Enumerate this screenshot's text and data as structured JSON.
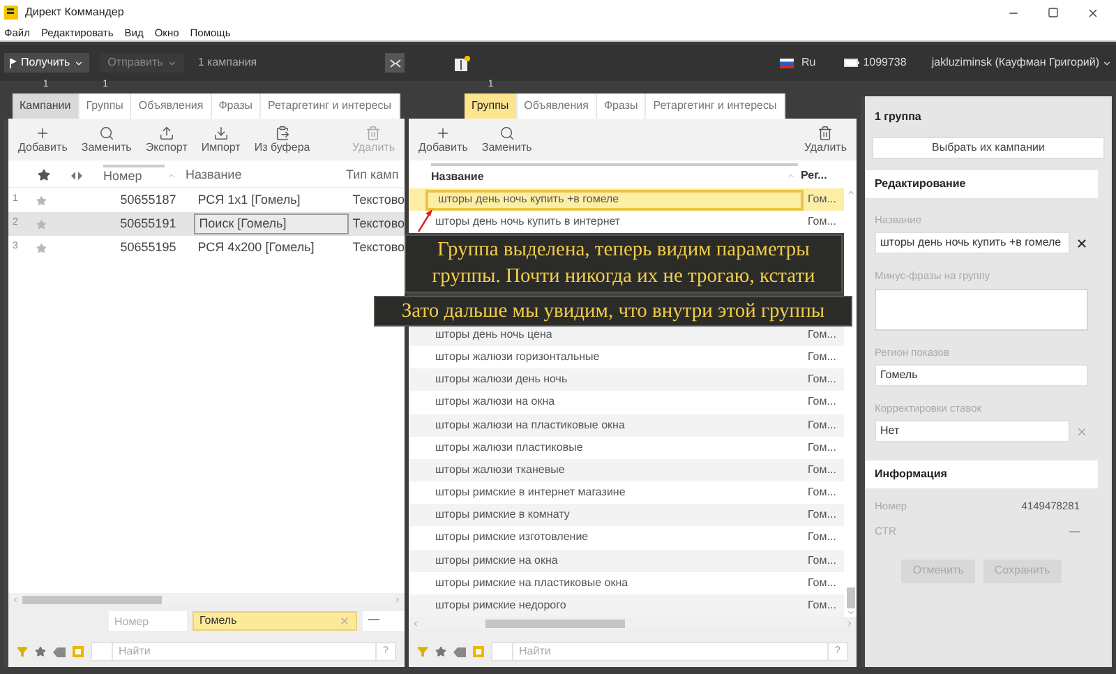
{
  "window": {
    "title": "Директ Коммандер"
  },
  "menu": [
    "Файл",
    "Редактировать",
    "Вид",
    "Окно",
    "Помощь"
  ],
  "toolbar": {
    "receive": "Получить",
    "send": "Отправить",
    "send_disabled": true,
    "campaign_count": "1 кампания",
    "language": "Ru",
    "balance": "1099738",
    "user": "jakluziminsk (Кауфман Григорий)"
  },
  "left_panel": {
    "tabs": [
      {
        "label": "Кампании",
        "selected": true,
        "badge": "1"
      },
      {
        "label": "Группы",
        "selected": false,
        "badge": "1"
      },
      {
        "label": "Объявления",
        "selected": false
      },
      {
        "label": "Фразы",
        "selected": false
      },
      {
        "label": "Ретаргетинг и интересы",
        "selected": false
      }
    ],
    "actions": [
      {
        "label": "Добавить",
        "kind": "add",
        "disabled": false
      },
      {
        "label": "Заменить",
        "kind": "replace",
        "disabled": false
      },
      {
        "label": "Экспорт",
        "kind": "export",
        "disabled": false
      },
      {
        "label": "Импорт",
        "kind": "import",
        "disabled": false
      },
      {
        "label": "Из буфера",
        "kind": "paste",
        "disabled": false
      },
      {
        "label": "Удалить",
        "kind": "delete",
        "disabled": true
      }
    ],
    "columns": [
      "Номер",
      "Название",
      "Тип камп"
    ],
    "rows": [
      {
        "index": "1",
        "number": "50655187",
        "name": "РСЯ 1x1 [Гомель]",
        "type": "Текстово",
        "selected": false
      },
      {
        "index": "2",
        "number": "50655191",
        "name": "Поиск [Гомель]",
        "type": "Текстово",
        "selected": true
      },
      {
        "index": "3",
        "number": "50655195",
        "name": "РСЯ 4x200 [Гомель]",
        "type": "Текстово",
        "selected": false
      }
    ],
    "filters": {
      "number_placeholder": "Номер",
      "region": "Гомель",
      "extra": "—"
    },
    "search": {
      "placeholder": "Найти",
      "help": "?"
    }
  },
  "middle_panel": {
    "tabs": [
      {
        "label": "Группы",
        "selected": true,
        "badge": "1"
      },
      {
        "label": "Объявления",
        "selected": false
      },
      {
        "label": "Фразы",
        "selected": false
      },
      {
        "label": "Ретаргетинг и интересы",
        "selected": false
      }
    ],
    "actions": [
      {
        "label": "Добавить",
        "kind": "add",
        "disabled": false
      },
      {
        "label": "Заменить",
        "kind": "replace",
        "disabled": false
      },
      {
        "label": "Удалить",
        "kind": "delete",
        "disabled": false
      }
    ],
    "columns": [
      "Название",
      "Рег..."
    ],
    "rows": [
      {
        "name": "шторы день ночь купить +в гомеле",
        "region": "Гом...",
        "selected": true
      },
      {
        "name": "шторы день ночь купить в интернет",
        "region": "Гом...",
        "selected": false
      },
      {},
      {},
      {},
      {},
      {
        "name": "шторы день ночь цена",
        "region": "Гом...",
        "selected": false
      },
      {
        "name": "шторы жалюзи горизонтальные",
        "region": "Гом...",
        "selected": false
      },
      {
        "name": "шторы жалюзи день ночь",
        "region": "Гом...",
        "selected": false
      },
      {
        "name": "шторы жалюзи на окна",
        "region": "Гом...",
        "selected": false
      },
      {
        "name": "шторы жалюзи на пластиковые окна",
        "region": "Гом...",
        "selected": false
      },
      {
        "name": "шторы жалюзи пластиковые",
        "region": "Гом...",
        "selected": false
      },
      {
        "name": "шторы жалюзи тканевые",
        "region": "Гом...",
        "selected": false
      },
      {
        "name": "шторы римские в интернет магазине",
        "region": "Гом...",
        "selected": false
      },
      {
        "name": "шторы римские в комнату",
        "region": "Гом...",
        "selected": false
      },
      {
        "name": "шторы римские изготовление",
        "region": "Гом...",
        "selected": false
      },
      {
        "name": "шторы римские на окна",
        "region": "Гом...",
        "selected": false
      },
      {
        "name": "шторы римские на пластиковые окна",
        "region": "Гом...",
        "selected": false
      },
      {
        "name": "шторы римские недорого",
        "region": "Гом...",
        "selected": false
      }
    ],
    "search": {
      "placeholder": "Найти",
      "help": "?"
    }
  },
  "details": {
    "title": "1 группа",
    "choose_button": "Выбрать их кампании",
    "editing": {
      "heading": "Редактирование",
      "fields": [
        {
          "label": "Название",
          "value": "шторы день ночь купить +в гомеле",
          "kind": "input",
          "clearable": true,
          "clear_disabled": false
        },
        {
          "label": "Минус-фразы на группу",
          "kind": "textarea"
        },
        {
          "label": "Регион показов",
          "value": "Гомель",
          "kind": "input"
        },
        {
          "label": "Корректировки ставок",
          "value": "Нет",
          "kind": "input",
          "clearable": true,
          "clear_disabled": true
        }
      ]
    },
    "info": {
      "heading": "Информация",
      "rows": [
        {
          "label": "Номер",
          "value": "4149478281"
        },
        {
          "label": "CTR",
          "value": "—"
        }
      ]
    },
    "buttons": [
      {
        "label": "Отменить",
        "disabled": true
      },
      {
        "label": "Сохранить",
        "disabled": true
      }
    ]
  },
  "captions": [
    "Группа выделена, теперь видим параметры группы. Почти никогда их не трогаю, кстати",
    "Зато дальше мы увидим, что внутри этой группы"
  ]
}
